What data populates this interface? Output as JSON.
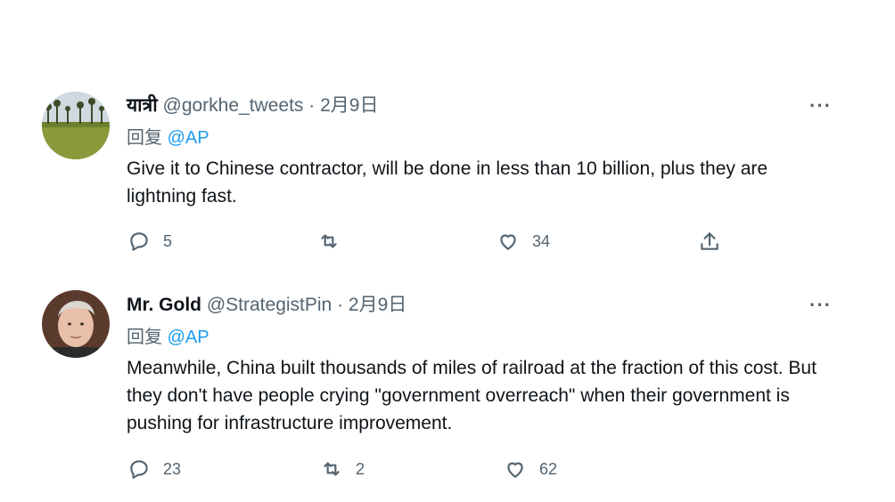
{
  "tweets": [
    {
      "name": "यात्री",
      "handle": "@gorkhe_tweets",
      "dot": "·",
      "date": "2月9日",
      "more": "···",
      "reply_prefix": "回复",
      "reply_to": "@AP",
      "text": "Give it to Chinese contractor, will be done in less than 10 billion, plus they are lightning fast.",
      "replies": "5",
      "retweets": "",
      "likes": "34",
      "avatar_icon": "landscape-avatar"
    },
    {
      "name": "Mr. Gold",
      "handle": "@StrategistPin",
      "dot": "·",
      "date": "2月9日",
      "more": "···",
      "reply_prefix": "回复",
      "reply_to": "@AP",
      "text": "Meanwhile, China built thousands of miles of railroad at the fraction of this cost. But they don't have people crying \"government overreach\" when their government is pushing for infrastructure improvement.",
      "replies": "23",
      "retweets": "2",
      "likes": "62",
      "avatar_icon": "portrait-avatar"
    }
  ],
  "colors": {
    "text": "#0f1419",
    "secondary": "#536471",
    "link": "#1d9bf0",
    "background": "#ffffff"
  }
}
